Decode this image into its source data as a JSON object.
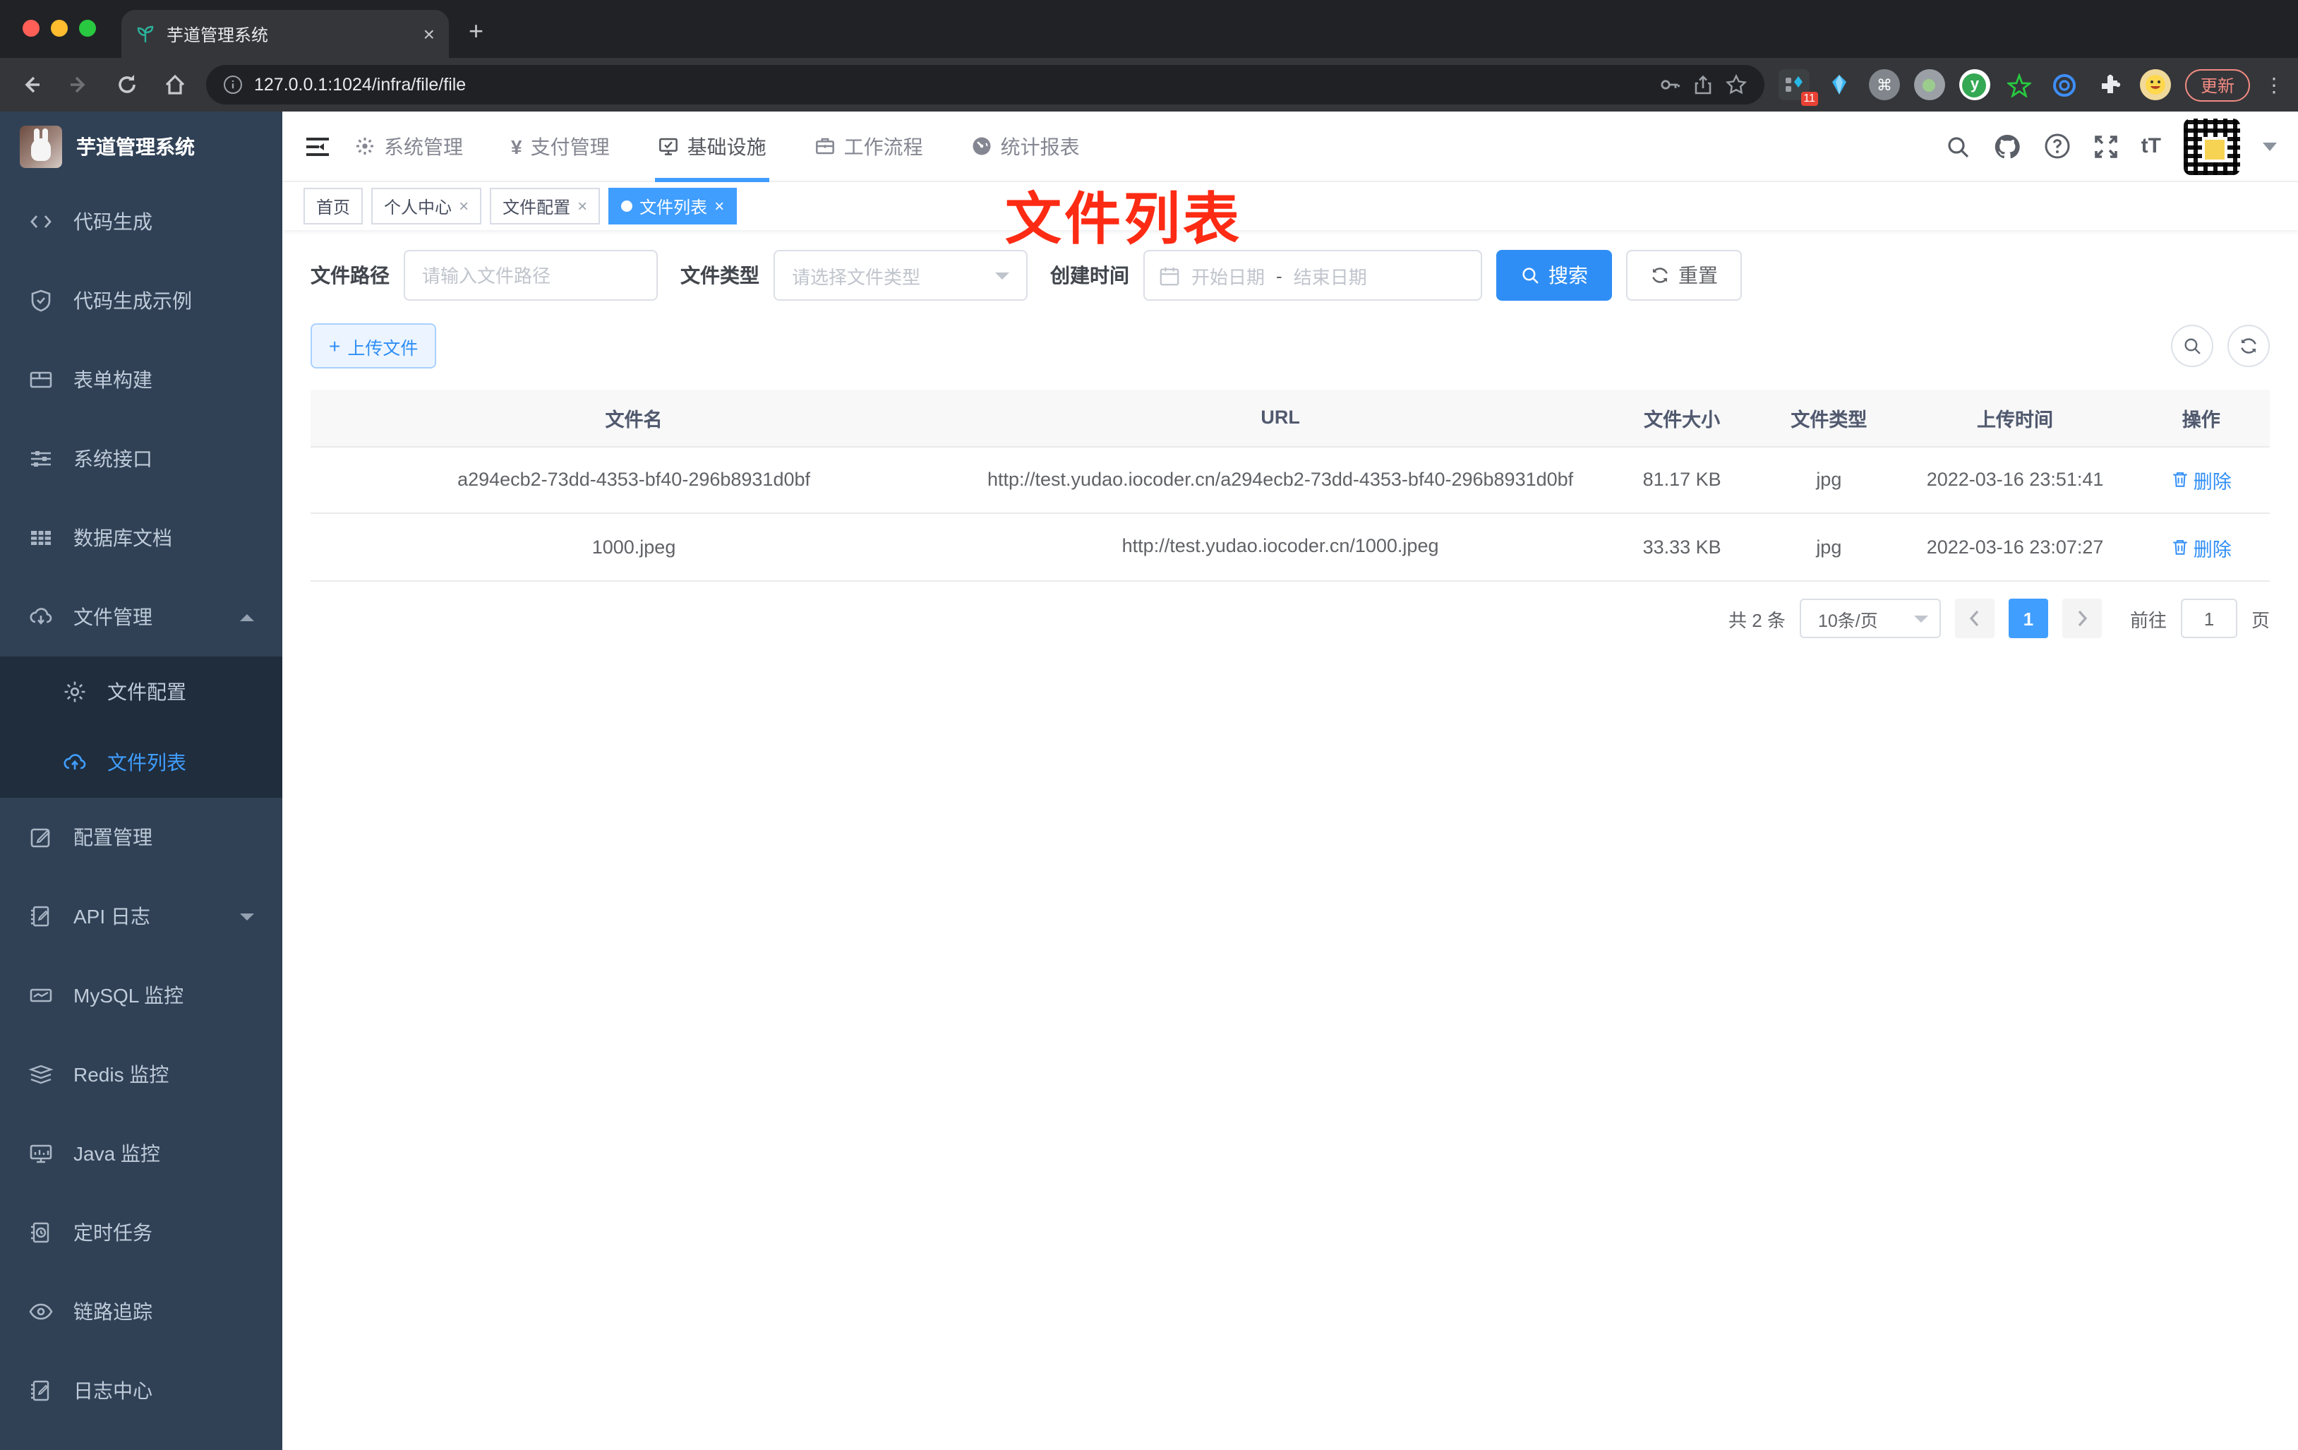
{
  "browser": {
    "tab_title": "芋道管理系统",
    "tab_close": "×",
    "new_tab": "+",
    "url": "127.0.0.1:1024/infra/file/file",
    "extension_badge": "11",
    "extension_y": "y",
    "update_button": "更新",
    "kebab": "⋮"
  },
  "sidebar": {
    "logo_title": "芋道管理系统",
    "items": [
      {
        "icon": "code-icon",
        "label": "代码生成"
      },
      {
        "icon": "shield-check-icon",
        "label": "代码生成示例"
      },
      {
        "icon": "form-icon",
        "label": "表单构建"
      },
      {
        "icon": "sliders-icon",
        "label": "系统接口"
      },
      {
        "icon": "table-icon",
        "label": "数据库文档"
      },
      {
        "icon": "cloud-download-icon",
        "label": "文件管理"
      },
      {
        "icon": "edit-square-icon",
        "label": "配置管理"
      },
      {
        "icon": "log-icon",
        "label": "API 日志"
      },
      {
        "icon": "chart-icon",
        "label": "MySQL 监控"
      },
      {
        "icon": "layers-icon",
        "label": "Redis 监控"
      },
      {
        "icon": "monitor-icon",
        "label": "Java 监控"
      },
      {
        "icon": "timer-icon",
        "label": "定时任务"
      },
      {
        "icon": "eye-icon",
        "label": "链路追踪"
      },
      {
        "icon": "log-icon",
        "label": "日志中心"
      }
    ],
    "submenu": [
      {
        "icon": "gear-icon",
        "label": "文件配置"
      },
      {
        "icon": "cloud-upload-icon",
        "label": "文件列表"
      }
    ]
  },
  "header": {
    "menus": [
      {
        "icon": "gear-icon",
        "label": "系统管理"
      },
      {
        "icon": "yen-icon",
        "label": "支付管理"
      },
      {
        "icon": "infra-icon",
        "label": "基础设施"
      },
      {
        "icon": "briefcase-icon",
        "label": "工作流程"
      },
      {
        "icon": "gauge-icon",
        "label": "统计报表"
      }
    ],
    "yen": "¥",
    "font_size_tool": "tT"
  },
  "tags": {
    "close": "×",
    "items": [
      {
        "label": "首页"
      },
      {
        "label": "个人中心"
      },
      {
        "label": "文件配置"
      },
      {
        "label": "文件列表"
      }
    ]
  },
  "annotation": {
    "text": "文件列表",
    "color": "#fd2b14"
  },
  "filters": {
    "path_label": "文件路径",
    "path_placeholder": "请输入文件路径",
    "type_label": "文件类型",
    "type_placeholder": "请选择文件类型",
    "date_label": "创建时间",
    "date_start_placeholder": "开始日期",
    "date_separator": "-",
    "date_end_placeholder": "结束日期",
    "search_label": "搜索",
    "reset_label": "重置"
  },
  "toolbar": {
    "upload_label": "上传文件",
    "upload_plus": "+"
  },
  "table": {
    "headers": [
      "文件名",
      "URL",
      "文件大小",
      "文件类型",
      "上传时间",
      "操作"
    ],
    "rows": [
      {
        "name": "a294ecb2-73dd-4353-bf40-296b8931d0bf",
        "url": "http://test.yudao.iocoder.cn/a294ecb2-73dd-4353-bf40-296b8931d0bf",
        "size": "81.17 KB",
        "type": "jpg",
        "time": "2022-03-16 23:51:41",
        "action": "删除"
      },
      {
        "name": "1000.jpeg",
        "url": "http://test.yudao.iocoder.cn/1000.jpeg",
        "size": "33.33 KB",
        "type": "jpg",
        "time": "2022-03-16 23:07:27",
        "action": "删除"
      }
    ]
  },
  "pagination": {
    "total": "共 2 条",
    "page_size": "10条/页",
    "current_page": "1",
    "goto_label": "前往",
    "goto_value": "1",
    "page_unit": "页"
  },
  "colors": {
    "primary": "#409eff",
    "sidebar_bg": "#304156",
    "submenu_bg": "#1f2d3d",
    "annotation_red": "#fd2b14",
    "table_header_bg": "#f8f8f9"
  }
}
